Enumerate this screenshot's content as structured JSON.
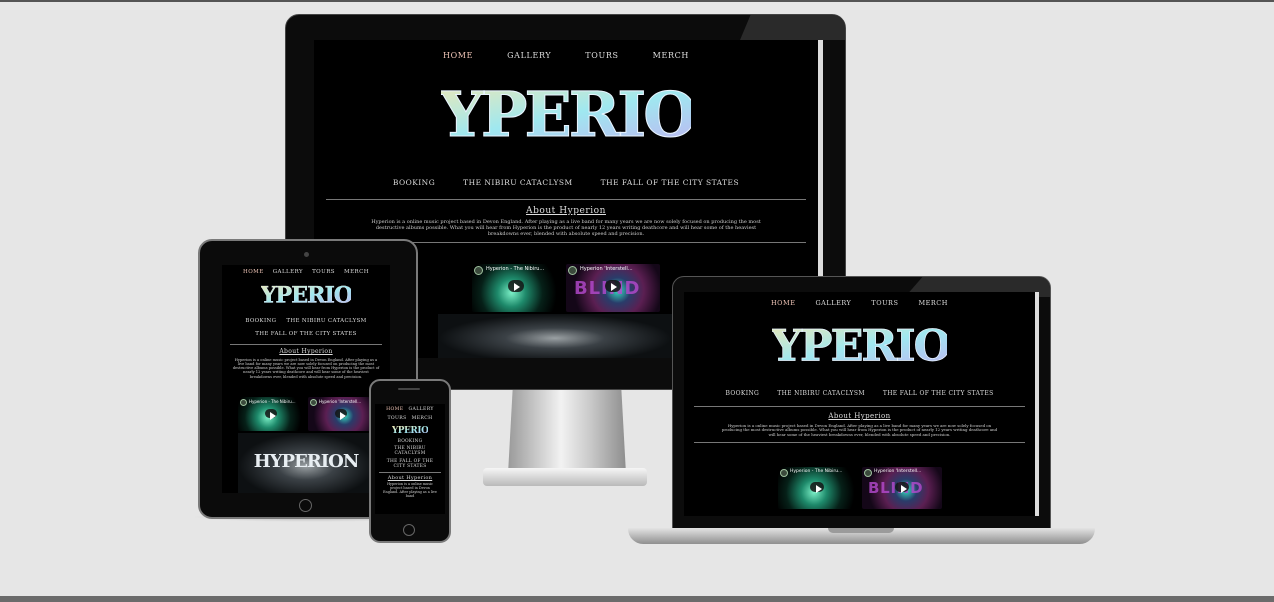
{
  "site": {
    "nav": [
      "HOME",
      "GALLERY",
      "TOURS",
      "MERCH"
    ],
    "sub_nav": [
      "BOOKING",
      "THE NIBIRU CATACLYSM",
      "THE FALL OF THE CITY STATES"
    ],
    "logo_text": "HYPERION",
    "about_heading": "About Hyperion",
    "about_text": "Hyperion is a online music project based in Devon England. After playing as a live band for many years we are now solely focused on producing the most destructive albums possible. What you will hear from Hyperion is the product of nearly 12 years writing deathcore and will hear some of the heaviest breakdowns ever, blended with absolute speed and precision.",
    "about_text_phone": "Hyperion is a online music project based in Devon England. After playing as a live band",
    "videos": [
      {
        "title": "Hyperion - The Nibiru..."
      },
      {
        "title": "Hyperion 'Interstell..."
      }
    ],
    "video2_overlay": "BLIND",
    "banner_text": "HYPERION"
  },
  "colors": {
    "page_bg": "#e6e6e6",
    "screen_bg": "#000000",
    "active_nav": "#f1c6b8",
    "device_body": "#111111"
  }
}
